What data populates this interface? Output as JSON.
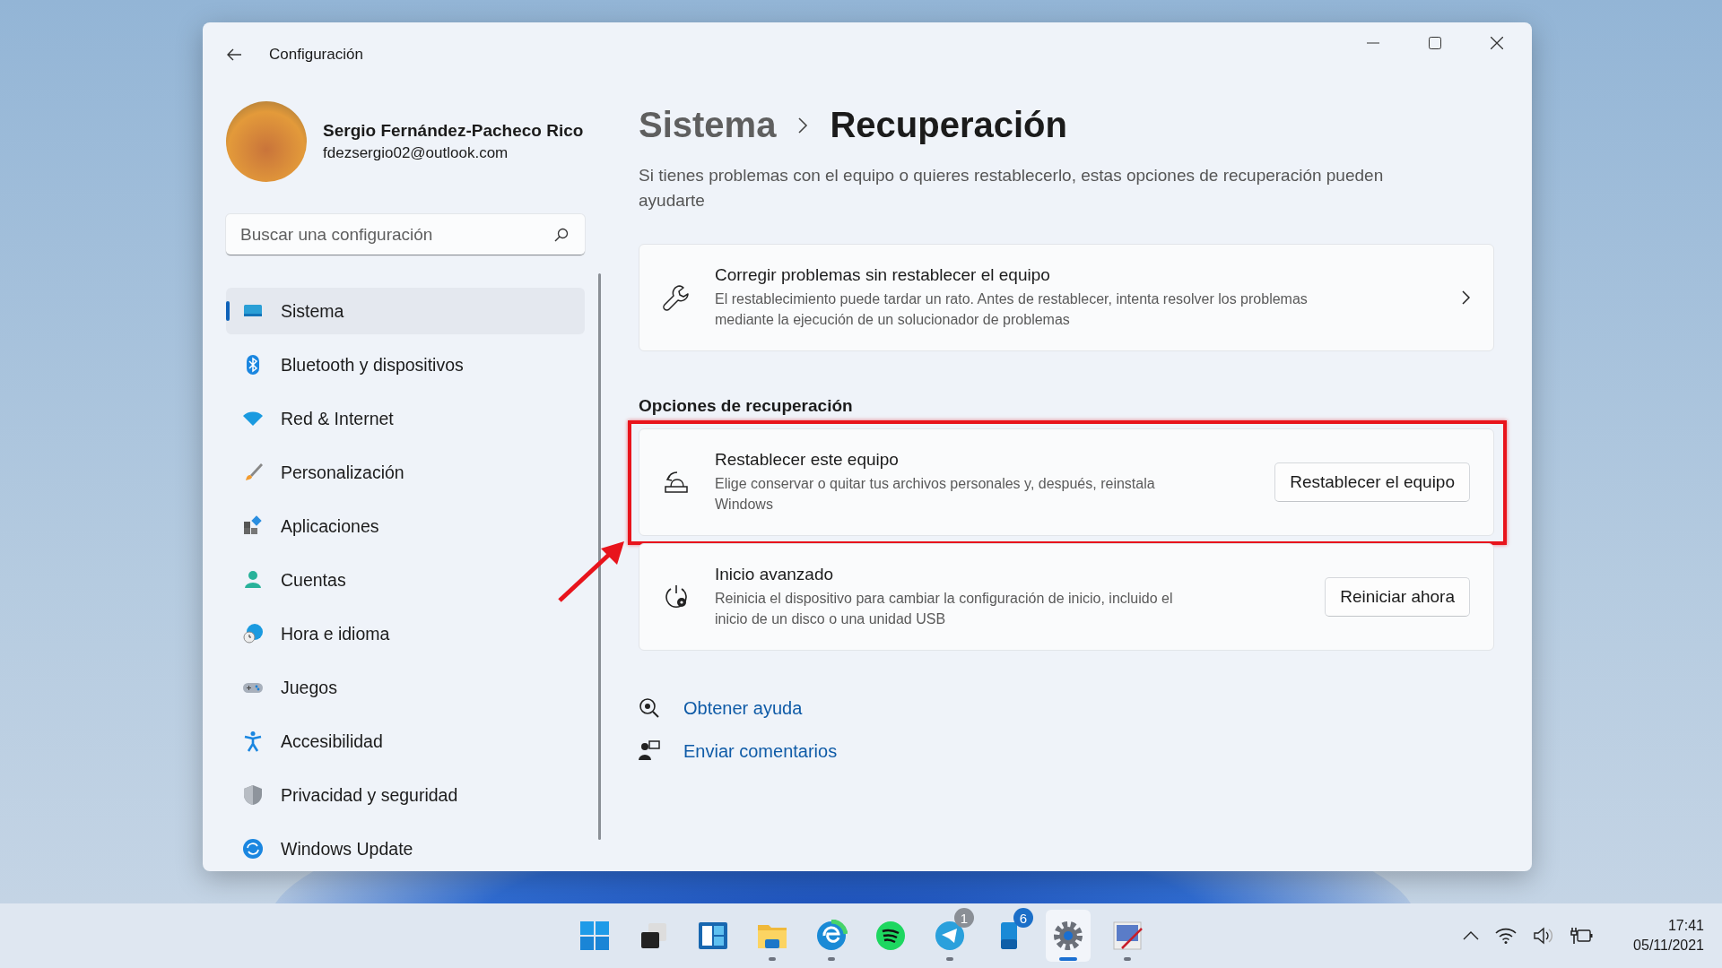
{
  "window": {
    "title": "Configuración"
  },
  "user": {
    "name": "Sergio Fernández-Pacheco Rico",
    "email": "fdezsergio02@outlook.com"
  },
  "search": {
    "placeholder": "Buscar una configuración"
  },
  "sidebar": {
    "items": [
      {
        "label": "Sistema",
        "selected": true
      },
      {
        "label": "Bluetooth y dispositivos",
        "selected": false
      },
      {
        "label": "Red & Internet",
        "selected": false
      },
      {
        "label": "Personalización",
        "selected": false
      },
      {
        "label": "Aplicaciones",
        "selected": false
      },
      {
        "label": "Cuentas",
        "selected": false
      },
      {
        "label": "Hora e idioma",
        "selected": false
      },
      {
        "label": "Juegos",
        "selected": false
      },
      {
        "label": "Accesibilidad",
        "selected": false
      },
      {
        "label": "Privacidad y seguridad",
        "selected": false
      },
      {
        "label": "Windows Update",
        "selected": false
      }
    ]
  },
  "breadcrumb": {
    "parent": "Sistema",
    "current": "Recuperación"
  },
  "description": "Si tienes problemas con el equipo o quieres restablecerlo, estas opciones de recuperación pueden ayudarte",
  "fix_card": {
    "title": "Corregir problemas sin restablecer el equipo",
    "description": "El restablecimiento puede tardar un rato. Antes de restablecer, intenta resolver los problemas mediante la ejecución de un solucionador de problemas"
  },
  "section_title": "Opciones de recuperación",
  "options": [
    {
      "title": "Restablecer este equipo",
      "description": "Elige conservar o quitar tus archivos personales y, después, reinstala Windows",
      "button": "Restablecer el equipo",
      "highlighted": true
    },
    {
      "title": "Inicio avanzado",
      "description": "Reinicia el dispositivo para cambiar la configuración de inicio, incluido el inicio de un disco o una unidad USB",
      "button": "Reiniciar ahora",
      "highlighted": false
    }
  ],
  "links": [
    {
      "label": "Obtener ayuda"
    },
    {
      "label": "Enviar comentarios"
    }
  ],
  "taskbar": {
    "apps": [
      {
        "running": false,
        "active": false
      },
      {
        "running": false,
        "active": false
      },
      {
        "running": false,
        "active": false
      },
      {
        "running": true,
        "active": false
      },
      {
        "running": true,
        "active": false
      },
      {
        "running": false,
        "active": false
      },
      {
        "running": true,
        "active": false,
        "badge": "1"
      },
      {
        "running": false,
        "active": false,
        "badge": "6"
      },
      {
        "running": true,
        "active": true
      },
      {
        "running": true,
        "active": false
      }
    ],
    "time": "17:41",
    "date": "05/11/2021"
  }
}
